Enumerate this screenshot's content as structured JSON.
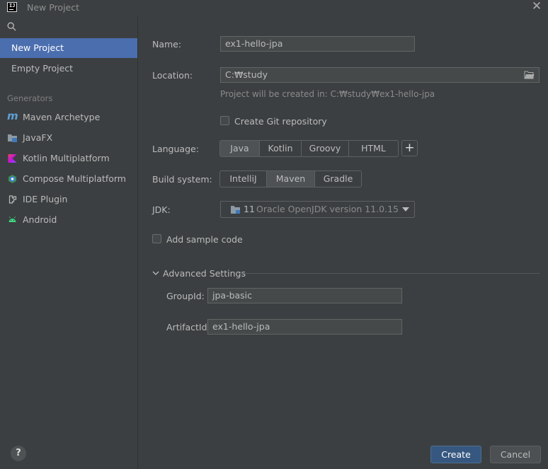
{
  "window": {
    "title": "New Project",
    "app_icon_text": "IJ"
  },
  "sidebar": {
    "search_icon": "search-icon",
    "items": [
      {
        "label": "New Project",
        "selected": true
      },
      {
        "label": "Empty Project",
        "selected": false
      }
    ],
    "generators_label": "Generators",
    "generators": [
      {
        "label": "Maven Archetype",
        "icon": "maven-icon"
      },
      {
        "label": "JavaFX",
        "icon": "javafx-icon"
      },
      {
        "label": "Kotlin Multiplatform",
        "icon": "kotlin-icon"
      },
      {
        "label": "Compose Multiplatform",
        "icon": "compose-icon"
      },
      {
        "label": "IDE Plugin",
        "icon": "plugin-icon"
      },
      {
        "label": "Android",
        "icon": "android-icon"
      }
    ]
  },
  "form": {
    "name_label": "Name:",
    "name_value": "ex1-hello-jpa",
    "location_label": "Location:",
    "location_value": "C:₩study",
    "location_hint": "Project will be created in: C:₩study₩ex1-hello-jpa",
    "git_label": "Create Git repository",
    "git_checked": false,
    "language_label": "Language:",
    "languages": [
      "Java",
      "Kotlin",
      "Groovy",
      "HTML"
    ],
    "language_selected": "Java",
    "add_language_symbol": "+",
    "build_label": "Build system:",
    "build_systems": [
      "IntelliJ",
      "Maven",
      "Gradle"
    ],
    "build_selected": "Maven",
    "jdk_label": "JDK:",
    "jdk_version": "11",
    "jdk_name": "Oracle OpenJDK version 11.0.15",
    "sample_label": "Add sample code",
    "sample_checked": false,
    "advanced_label": "Advanced Settings",
    "advanced_expanded": true,
    "groupid_label": "GroupId:",
    "groupid_value": "jpa-basic",
    "artifactid_label": "ArtifactId:",
    "artifactid_value": "ex1-hello-jpa"
  },
  "footer": {
    "help_symbol": "?",
    "create_label": "Create",
    "cancel_label": "Cancel"
  },
  "colors": {
    "background": "#3c3f41",
    "selection": "#4b6eaf",
    "primary_button": "#365880"
  }
}
